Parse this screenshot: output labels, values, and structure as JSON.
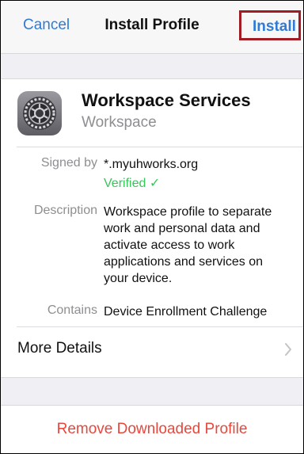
{
  "navbar": {
    "cancel_label": "Cancel",
    "title": "Install Profile",
    "install_label": "Install"
  },
  "profile": {
    "icon": "settings-gear-icon",
    "name": "Workspace Services",
    "organization": "Workspace"
  },
  "details": {
    "signed_by_label": "Signed by",
    "signed_by_value": "*.myuhworks.org",
    "verified_label": "Verified ✓",
    "description_label": "Description",
    "description_lines": [
      "Workspace profile to separate",
      "work and personal data and",
      "activate access to work",
      "applications and services on",
      "your device."
    ],
    "contains_label": "Contains",
    "contains_value": "Device Enrollment Challenge"
  },
  "more_details": {
    "label": "More Details",
    "icon": "chevron-right-icon"
  },
  "remove": {
    "label": "Remove Downloaded Profile"
  },
  "colors": {
    "accent": "#2f7bd6",
    "highlight_border": "#a21c25",
    "verified": "#35c759",
    "destructive": "#e8473c",
    "secondary_text": "#8e8e93",
    "background": "#efeff4"
  }
}
